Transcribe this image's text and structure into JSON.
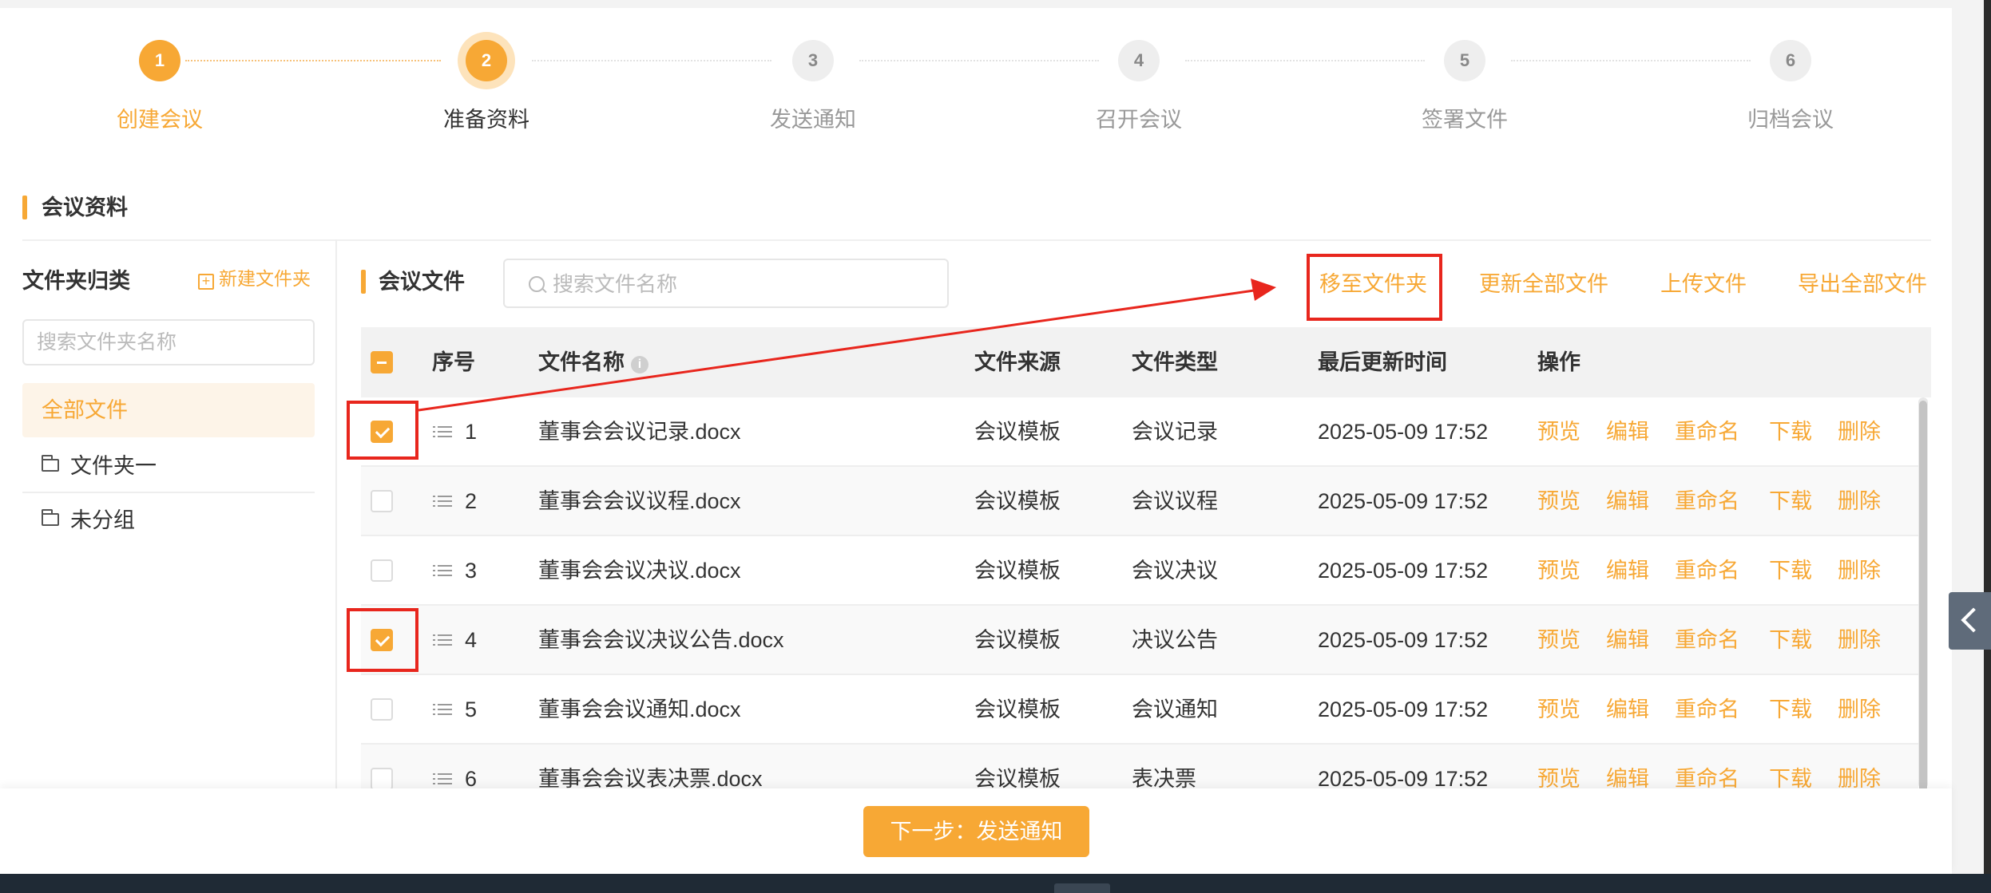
{
  "steps": [
    {
      "num": "1",
      "label": "创建会议",
      "state": "done"
    },
    {
      "num": "2",
      "label": "准备资料",
      "state": "current"
    },
    {
      "num": "3",
      "label": "发送通知",
      "state": "todo"
    },
    {
      "num": "4",
      "label": "召开会议",
      "state": "todo"
    },
    {
      "num": "5",
      "label": "签署文件",
      "state": "todo"
    },
    {
      "num": "6",
      "label": "归档会议",
      "state": "todo"
    }
  ],
  "section_title": "会议资料",
  "folders": {
    "title": "文件夹归类",
    "new_folder": "新建文件夹",
    "search_placeholder": "搜索文件夹名称",
    "all_files": "全部文件",
    "items": [
      "文件夹一",
      "未分组"
    ]
  },
  "files": {
    "title": "会议文件",
    "search_placeholder": "搜索文件名称",
    "actions": {
      "move": "移至文件夹",
      "update_all": "更新全部文件",
      "upload": "上传文件",
      "export_all": "导出全部文件"
    },
    "columns": {
      "seq": "序号",
      "name": "文件名称",
      "source": "文件来源",
      "type": "文件类型",
      "updated": "最后更新时间",
      "ops": "操作"
    },
    "info_icon": "i",
    "rows": [
      {
        "seq": "1",
        "name": "董事会会议记录.docx",
        "source": "会议模板",
        "type": "会议记录",
        "updated": "2025-05-09 17:52",
        "checked": true
      },
      {
        "seq": "2",
        "name": "董事会会议议程.docx",
        "source": "会议模板",
        "type": "会议议程",
        "updated": "2025-05-09 17:52",
        "checked": false
      },
      {
        "seq": "3",
        "name": "董事会会议决议.docx",
        "source": "会议模板",
        "type": "会议决议",
        "updated": "2025-05-09 17:52",
        "checked": false
      },
      {
        "seq": "4",
        "name": "董事会会议决议公告.docx",
        "source": "会议模板",
        "type": "决议公告",
        "updated": "2025-05-09 17:52",
        "checked": true
      },
      {
        "seq": "5",
        "name": "董事会会议通知.docx",
        "source": "会议模板",
        "type": "会议通知",
        "updated": "2025-05-09 17:52",
        "checked": false
      },
      {
        "seq": "6",
        "name": "董事会会议表决票.docx",
        "source": "会议模板",
        "type": "表决票",
        "updated": "2025-05-09 17:52",
        "checked": false
      }
    ],
    "row_ops": [
      "预览",
      "编辑",
      "重命名",
      "下载",
      "删除"
    ]
  },
  "next_button": "下一步：发送通知",
  "colors": {
    "accent": "#f7a835",
    "annotation": "#e8261d"
  },
  "icons": [
    "plus-square-icon",
    "folder-icon",
    "search-icon",
    "info-icon",
    "drag-handle-icon",
    "checkbox-icon",
    "chevron-left-icon"
  ]
}
